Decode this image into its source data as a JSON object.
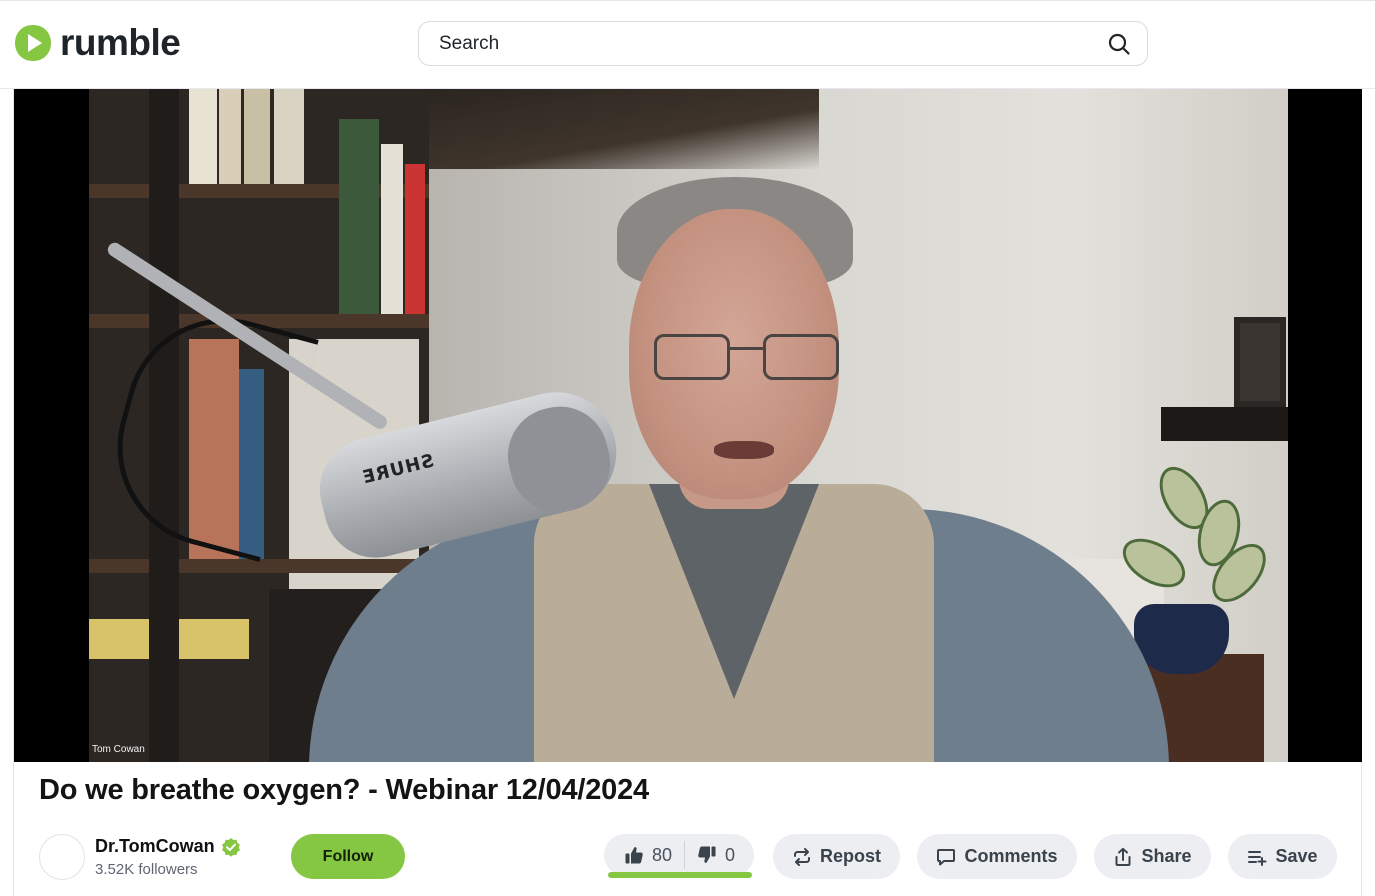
{
  "header": {
    "brand": "rumble",
    "search": {
      "placeholder": "Search",
      "value": ""
    }
  },
  "player": {
    "overlay_label": "Tom Cowan",
    "mic_brand": "SHURE"
  },
  "video": {
    "title": "Do we breathe oxygen? - Webinar 12/04/2024"
  },
  "channel": {
    "name": "Dr.TomCowan",
    "followers": "3.52K followers",
    "verified": true
  },
  "actions": {
    "follow_label": "Follow",
    "likes": "80",
    "dislikes": "0",
    "like_ratio": 1.0,
    "repost_label": "Repost",
    "comments_label": "Comments",
    "share_label": "Share",
    "save_label": "Save"
  },
  "colors": {
    "brand_green": "#85c742",
    "button_bg": "#eceef2",
    "text_dark": "#141414"
  },
  "icons": [
    "rumble-logo-icon",
    "search-icon",
    "verified-icon",
    "thumbs-up-icon",
    "thumbs-down-icon",
    "repost-icon",
    "comment-icon",
    "share-icon",
    "save-playlist-icon"
  ]
}
